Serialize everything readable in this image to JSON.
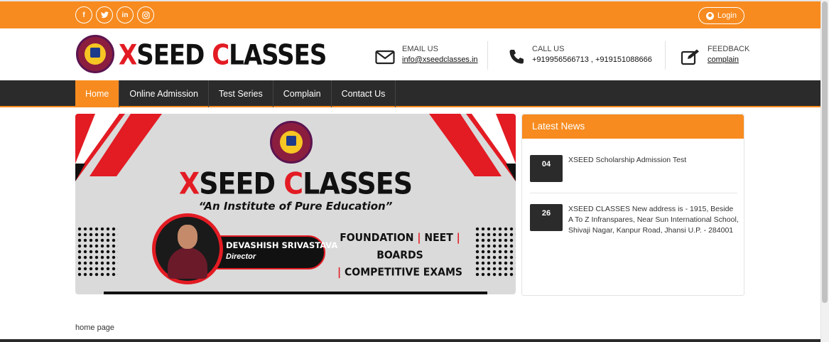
{
  "topbar": {
    "social": [
      {
        "icon": "facebook-icon",
        "glyph": "f"
      },
      {
        "icon": "twitter-icon",
        "glyph": "t"
      },
      {
        "icon": "linkedin-icon",
        "glyph": "in"
      },
      {
        "icon": "instagram-icon",
        "glyph": "◎"
      }
    ],
    "login_label": "Login"
  },
  "header": {
    "brand_first": "X",
    "brand_mid": "SEED ",
    "brand_second": "C",
    "brand_rest": "LASSES",
    "email_label": "EMAIL US",
    "email_value": "info@xseedclasses.in",
    "call_label": "CALL US",
    "call_value": "+919956566713 , +919151088666",
    "feedback_label": "FEEDBACK",
    "feedback_value": "complain"
  },
  "nav": {
    "items": [
      "Home",
      "Online Admission",
      "Test Series",
      "Complain",
      "Contact Us"
    ]
  },
  "banner": {
    "title_first": "X",
    "title_mid": "SEED ",
    "title_second": "C",
    "title_rest": "LASSES",
    "tagline": "“An Institute of Pure Education”",
    "person_name": "DEVASHISH SRIVASTAVA",
    "person_role": "Director",
    "course_foundation": "FOUNDATION",
    "course_neet": "NEET",
    "course_boards": "BOARDS",
    "course_competitive": "COMPETITIVE EXAMS"
  },
  "news": {
    "heading": "Latest News",
    "items": [
      {
        "date": "04",
        "text": "XSEED Scholarship Admission Test"
      },
      {
        "date": "26",
        "text": "XSEED CLASSES New address is - 1915, Beside A To Z Infranspares, Near Sun International School, Shivaji Nagar, Kanpur Road, Jhansi U.P. - 284001"
      }
    ]
  },
  "footer": {
    "text": "home page"
  },
  "colors": {
    "accent": "#f78b1f",
    "dark": "#2b2b2b",
    "brand_red": "#e31b23"
  }
}
